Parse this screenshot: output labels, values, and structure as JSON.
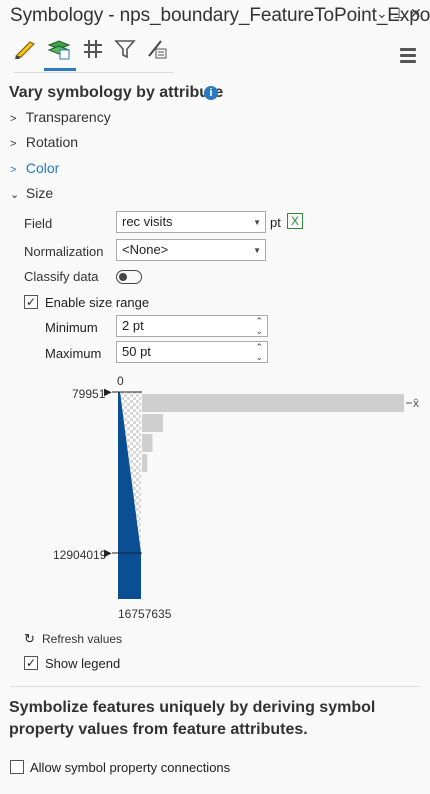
{
  "window": {
    "title": "Symbology - nps_boundary_FeatureToPoint_Expo...",
    "controls": [
      "chevron-down-icon",
      "pin-icon",
      "close-icon"
    ]
  },
  "tabs": [
    {
      "name": "primary-symbology",
      "icon": "brush-icon"
    },
    {
      "name": "vary-by-attribute",
      "icon": "layer-map-icon",
      "selected": true
    },
    {
      "name": "symbol-layer-drawing",
      "icon": "grid-icon"
    },
    {
      "name": "symbol-filter",
      "icon": "funnel-icon"
    },
    {
      "name": "label-settings",
      "icon": "ruler-list-icon"
    }
  ],
  "heading": "Vary symbology by attribute",
  "sections": {
    "transparency": "Transparency",
    "rotation": "Rotation",
    "color": "Color",
    "size": "Size"
  },
  "size": {
    "field_label": "Field",
    "field_value": "rec visits",
    "field_unit": "pt",
    "normalization_label": "Normalization",
    "normalization_value": "<None>",
    "classify_label": "Classify data",
    "classify_on": false,
    "enable_range_label": "Enable size range",
    "enable_range_checked": true,
    "minimum_label": "Minimum",
    "minimum_value": "2 pt",
    "maximum_label": "Maximum",
    "maximum_value": "50 pt"
  },
  "histogram": {
    "top_label": "0",
    "upper_handle": "79951",
    "lower_handle": "12904019",
    "bottom_label": "16757635",
    "mean_label": "x̄",
    "bars": [
      1.0,
      0.08,
      0.04,
      0.02
    ],
    "colors": {
      "ramp": "#0a4f94",
      "bar": "#cfcfcf"
    }
  },
  "refresh_label": "Refresh values",
  "show_legend_label": "Show legend",
  "show_legend_checked": true,
  "description": "Symbolize features uniquely by deriving symbol property values from feature attributes.",
  "allow_connections_label": "Allow symbol property connections",
  "allow_connections_checked": false
}
